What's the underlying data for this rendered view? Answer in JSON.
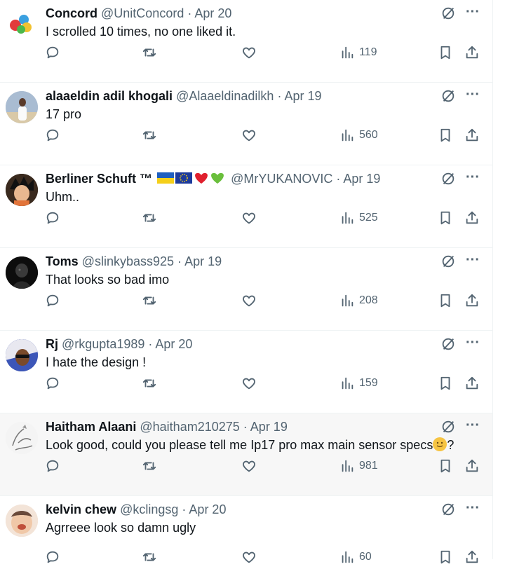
{
  "tweets": [
    {
      "name": "Concord",
      "handle": "@UnitConcord",
      "date": "Apr 20",
      "text": "I scrolled 10 times, no one liked it.",
      "views": "119",
      "avatar_color": "#e6e6e6"
    },
    {
      "name": "alaaeldin adil khogali",
      "handle": "@Alaaeldinadilkh",
      "date": "Apr 19",
      "text": "17 pro",
      "views": "560",
      "avatar_color": "#b9c7d8"
    },
    {
      "name": "Berliner Schuft ™",
      "handle": "@MrYUKANOVIC",
      "date": "Apr 19",
      "text": "Uhm..",
      "views": "525",
      "avatar_color": "#3a2a1e"
    },
    {
      "name": "Toms",
      "handle": "@slinkybass925",
      "date": "Apr 19",
      "text": "That looks so bad imo",
      "views": "208",
      "avatar_color": "#111111"
    },
    {
      "name": "Rj",
      "handle": "@rkgupta1989",
      "date": "Apr 20",
      "text": "I hate the design !",
      "views": "159",
      "avatar_color": "#2d3f8a"
    },
    {
      "name": "Haitham Alaani",
      "handle": "@haitham210275",
      "date": "Apr 19",
      "text": "Look good, could you please tell me Ip17 pro max main sensor specs",
      "text_suffix": "?",
      "views": "981",
      "avatar_color": "#f2f2f2"
    },
    {
      "name": "kelvin chew",
      "handle": "@kclingsg",
      "date": "Apr 20",
      "text": "Agrreee look so damn ugly",
      "views": "60",
      "avatar_color": "#f0d2c0"
    }
  ],
  "separator": "·",
  "more_glyph": "···",
  "colors": {
    "text": "#0f1419",
    "secondary": "#536471",
    "divider": "#eff3f4",
    "hover_bg": "#f7f7f7"
  }
}
